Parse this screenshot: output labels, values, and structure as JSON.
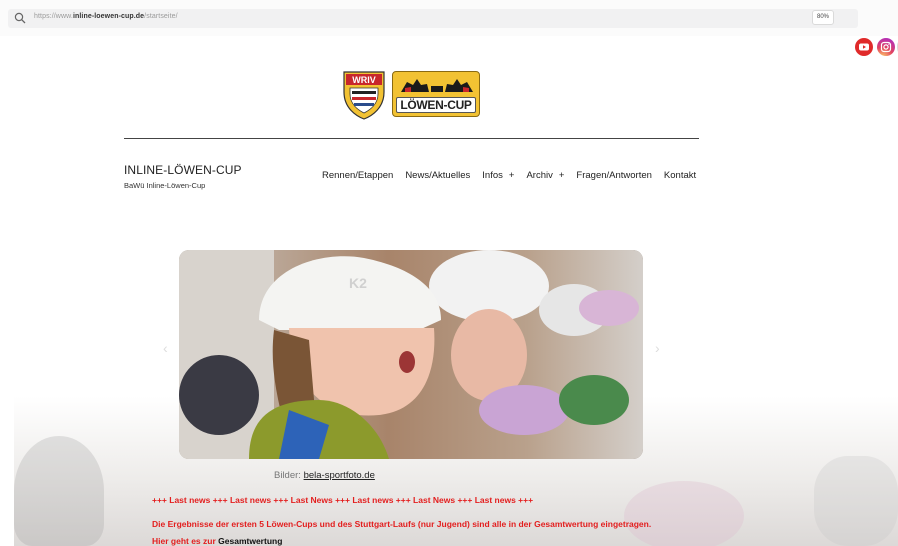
{
  "browser": {
    "url_prefix": "https://www.",
    "url_host": "inline-loewen-cup.de",
    "url_path": "/startseite/",
    "zoom": "80%",
    "search_icon": "search-icon"
  },
  "social": {
    "youtube_icon": "youtube-icon",
    "instagram_icon": "instagram-icon"
  },
  "logos": {
    "wriv_text": "WRIV",
    "cup_text": "LÖWEN-CUP"
  },
  "site": {
    "title": "INLINE-LÖWEN-CUP",
    "subtitle": "BaWü Inline-Löwen-Cup"
  },
  "nav": {
    "items": [
      "Rennen/Etappen",
      "News/Aktuelles",
      "Infos",
      "Archiv",
      "Fragen/Antworten",
      "Kontakt"
    ],
    "plus": "+"
  },
  "slider": {
    "prev_icon": "chevron-left-icon",
    "next_icon": "chevron-right-icon"
  },
  "credit": {
    "label": "Bilder:",
    "link": "bela-sportfoto.de"
  },
  "news": {
    "ticker": "+++ Last news +++ Last news +++ Last News +++ Last news +++ Last News +++ Last news +++",
    "line1": "Die Ergebnisse der ersten 5 Löwen-Cups und des Stuttgart-Laufs (nur Jugend) sind alle in der Gesamtwertung eingetragen.",
    "line2_prefix": "Hier geht es zur",
    "line2_link": "Gesamtwertung"
  },
  "colors": {
    "accent_red": "#e31e1e",
    "logo_yellow": "#f2c233",
    "youtube_red": "#e02a2a"
  }
}
